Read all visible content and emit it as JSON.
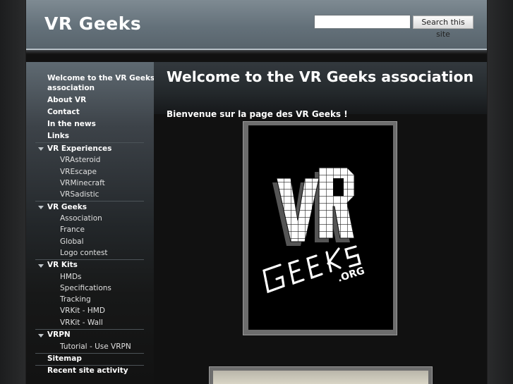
{
  "header": {
    "site_title": "VR Geeks",
    "search_placeholder": "",
    "search_button_label": "Search this site"
  },
  "sidebar": {
    "items": [
      {
        "label": "Welcome to the VR Geeks",
        "label2": "association",
        "level": 0
      },
      {
        "label": "About VR",
        "level": 0
      },
      {
        "label": "Contact",
        "level": 0
      },
      {
        "label": "In the news",
        "level": 0
      },
      {
        "label": "Links",
        "level": 0
      },
      {
        "label": "VR Experiences",
        "level": 0,
        "expanded": true
      },
      {
        "label": "VRAsteroid",
        "level": 1
      },
      {
        "label": "VREscape",
        "level": 1
      },
      {
        "label": "VRMinecraft",
        "level": 1
      },
      {
        "label": "VRSadistic",
        "level": 1
      },
      {
        "label": "VR Geeks",
        "level": 0,
        "expanded": true
      },
      {
        "label": "Association",
        "level": 1
      },
      {
        "label": "France",
        "level": 1
      },
      {
        "label": "Global",
        "level": 1
      },
      {
        "label": "Logo contest",
        "level": 1
      },
      {
        "label": "VR Kits",
        "level": 0,
        "expanded": true
      },
      {
        "label": "HMDs",
        "level": 1
      },
      {
        "label": "Specifications",
        "level": 1
      },
      {
        "label": "Tracking",
        "level": 1
      },
      {
        "label": "VRKit - HMD",
        "level": 1
      },
      {
        "label": "VRKit - Wall",
        "level": 1
      },
      {
        "label": "VRPN",
        "level": 0,
        "expanded": true
      },
      {
        "label": "Tutorial - Use VRPN",
        "level": 1
      },
      {
        "label": "Sitemap",
        "level": 0
      },
      {
        "label": "Recent site activity",
        "level": 0
      }
    ]
  },
  "main": {
    "page_title": "Welcome to the VR Geeks association",
    "intro": "Bienvenue sur la page des VR Geeks !",
    "logo": {
      "line1": "VR",
      "line2": "GEEKS",
      "line3": ".ORG"
    }
  },
  "colors": {
    "header": "#6a767e",
    "background": "#111111",
    "text": "#ffffff"
  }
}
